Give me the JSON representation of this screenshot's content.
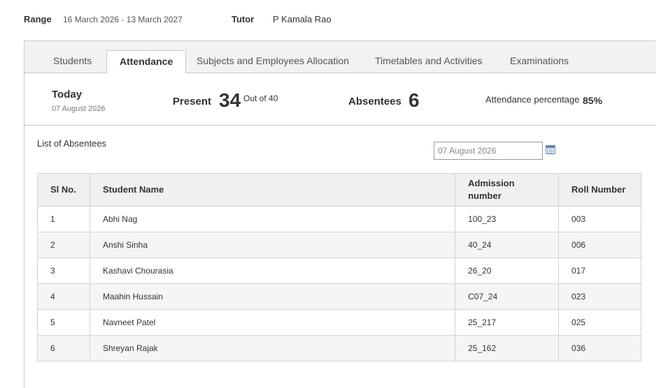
{
  "header": {
    "range_label": "Range",
    "range_value": "16 March 2026 - 13 March 2027",
    "tutor_label": "Tutor",
    "tutor_value": "P Kamala Rao"
  },
  "tabs": [
    {
      "label": "Students",
      "active": false
    },
    {
      "label": "Attendance",
      "active": true
    },
    {
      "label": "Subjects and Employees Allocation",
      "active": false
    },
    {
      "label": "Timetables and Activities",
      "active": false
    },
    {
      "label": "Examinations",
      "active": false
    }
  ],
  "summary": {
    "today_label": "Today",
    "today_date": "07 August 2026",
    "present_label": "Present",
    "present_count": "34",
    "out_of": "Out of 40",
    "absentees_label": "Absentees",
    "absentees_count": "6",
    "percentage_label": "Attendance percentage",
    "percentage_value": "85%"
  },
  "absentees": {
    "title": "List of Absentees",
    "date_value": "07 August 2026",
    "calendar_icon": "calendar-icon",
    "columns": [
      "Sl No.",
      "Student Name",
      "Admission number",
      "Roll Number"
    ],
    "rows": [
      [
        "1",
        "Abhi Nag",
        "100_23",
        "003"
      ],
      [
        "2",
        "Anshi Sinha",
        "40_24",
        "006"
      ],
      [
        "3",
        "Kashavi Chourasia",
        "26_20",
        "017"
      ],
      [
        "4",
        "Maahin Hussain",
        "C07_24",
        "023"
      ],
      [
        "5",
        "Navneet Patel",
        "25_217",
        "025"
      ],
      [
        "6",
        "Shreyan Rajak",
        "25_162",
        "036"
      ]
    ]
  }
}
